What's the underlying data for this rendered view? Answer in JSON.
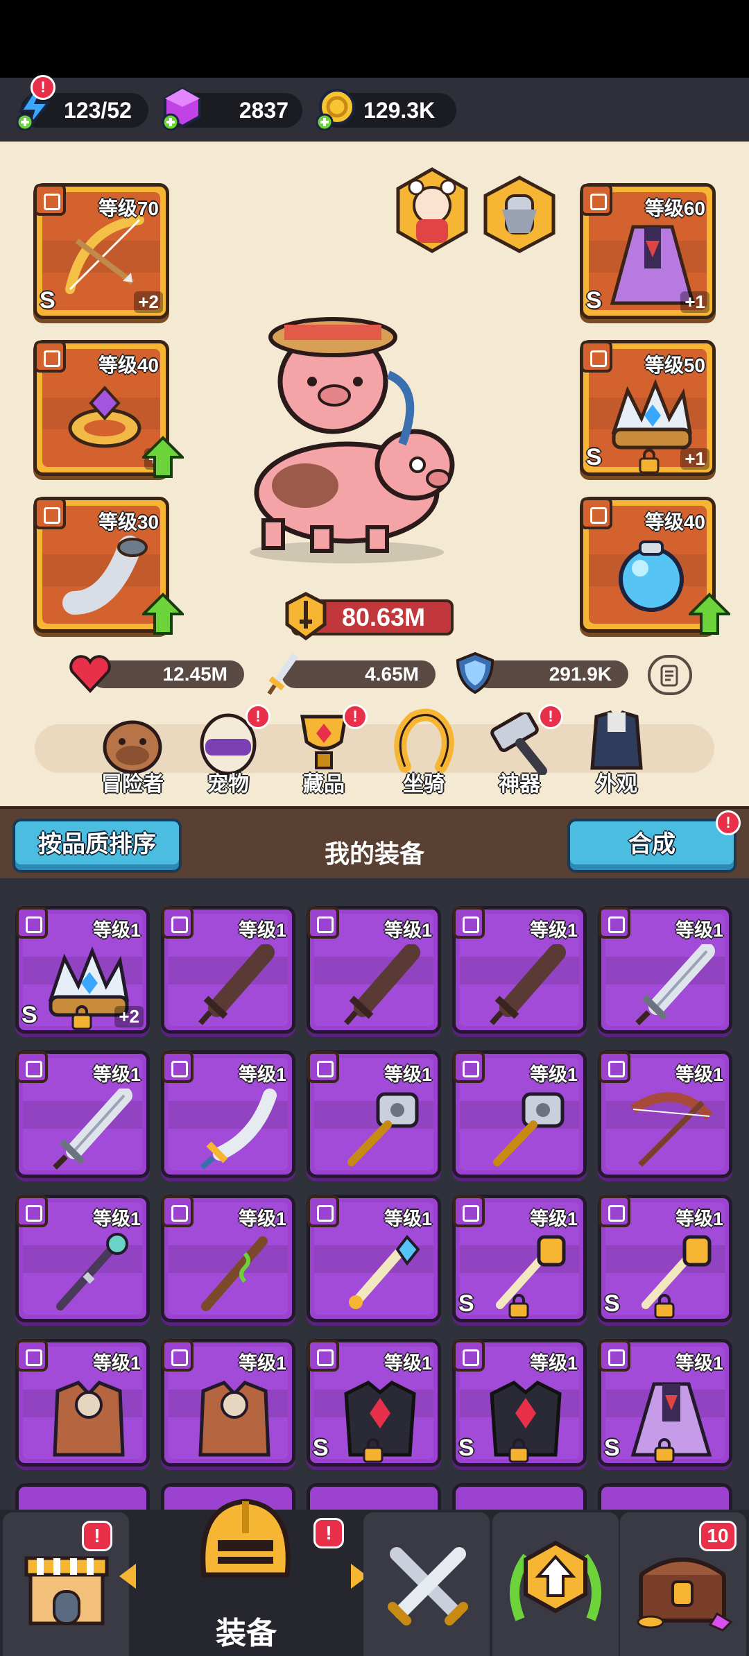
{
  "resources": {
    "energy": {
      "value": "123/52",
      "badge": "!"
    },
    "gems": {
      "value": "2837"
    },
    "gold": {
      "value": "129.3K"
    }
  },
  "hero": {
    "left_slots": [
      {
        "level": "等级70",
        "rarity": "S",
        "plus": "+2",
        "icon": "bow-icon"
      },
      {
        "level": "等级40",
        "plus": "+",
        "upgrade": true,
        "icon": "ring-icon"
      },
      {
        "level": "等级30",
        "upgrade": true,
        "icon": "horn-icon"
      }
    ],
    "right_slots": [
      {
        "level": "等级60",
        "rarity": "S",
        "plus": "+1",
        "icon": "cape-icon"
      },
      {
        "level": "等级50",
        "rarity": "S",
        "plus": "+1",
        "locked": true,
        "icon": "crown-icon"
      },
      {
        "level": "等级40",
        "upgrade": true,
        "icon": "orb-icon"
      }
    ],
    "power": "80.63M",
    "stats": {
      "hp": "12.45M",
      "attack": "4.65M",
      "defense": "291.9K"
    }
  },
  "menu": [
    {
      "label": "冒险者",
      "icon": "capybara-icon",
      "badge": ""
    },
    {
      "label": "宠物",
      "icon": "egg-icon",
      "badge": "!"
    },
    {
      "label": "藏品",
      "icon": "trophy-icon",
      "badge": "!"
    },
    {
      "label": "坐骑",
      "icon": "horseshoe-icon",
      "badge": ""
    },
    {
      "label": "神器",
      "icon": "hammer-icon",
      "badge": "!"
    },
    {
      "label": "外观",
      "icon": "outfit-icon",
      "badge": ""
    }
  ],
  "equipment": {
    "title": "我的装备",
    "sort_label": "按品质排序",
    "merge_label": "合成",
    "merge_badge": "!",
    "items": [
      {
        "level": "等级1",
        "type": "crown",
        "rarity": "S",
        "locked": true,
        "plus": "+2"
      },
      {
        "level": "等级1",
        "type": "wood-sword"
      },
      {
        "level": "等级1",
        "type": "wood-sword"
      },
      {
        "level": "等级1",
        "type": "wood-sword"
      },
      {
        "level": "等级1",
        "type": "steel-sword"
      },
      {
        "level": "等级1",
        "type": "steel-sword"
      },
      {
        "level": "等级1",
        "type": "sabre"
      },
      {
        "level": "等级1",
        "type": "mace"
      },
      {
        "level": "等级1",
        "type": "mace"
      },
      {
        "level": "等级1",
        "type": "bow"
      },
      {
        "level": "等级1",
        "type": "staff"
      },
      {
        "level": "等级1",
        "type": "staff-green"
      },
      {
        "level": "等级1",
        "type": "ice-wand"
      },
      {
        "level": "等级1",
        "type": "gold-wand",
        "rarity": "S",
        "locked": true
      },
      {
        "level": "等级1",
        "type": "gold-wand",
        "rarity": "S",
        "locked": true
      },
      {
        "level": "等级1",
        "type": "leather-armor"
      },
      {
        "level": "等级1",
        "type": "leather-armor"
      },
      {
        "level": "等级1",
        "type": "dark-armor",
        "rarity": "S",
        "locked": true
      },
      {
        "level": "等级1",
        "type": "dark-armor",
        "rarity": "S",
        "locked": true
      },
      {
        "level": "等级1",
        "type": "cape",
        "rarity": "S",
        "locked": true
      }
    ]
  },
  "nav": {
    "active_label": "装备",
    "tabs": [
      {
        "name": "shop",
        "icon": "shop-icon",
        "badge": "!"
      },
      {
        "name": "equipment",
        "icon": "helmet-icon",
        "badge": "!"
      },
      {
        "name": "battle",
        "icon": "crossed-swords-icon",
        "badge": ""
      },
      {
        "name": "upgrade",
        "icon": "upgrade-icon",
        "badge": ""
      },
      {
        "name": "chest",
        "icon": "chest-icon",
        "badge": "10"
      }
    ]
  },
  "colors": {
    "rare_purple": "#9b42d1",
    "legend_orange": "#f6b634",
    "accent_blue": "#4bbde0",
    "badge_red": "#e8304a"
  }
}
